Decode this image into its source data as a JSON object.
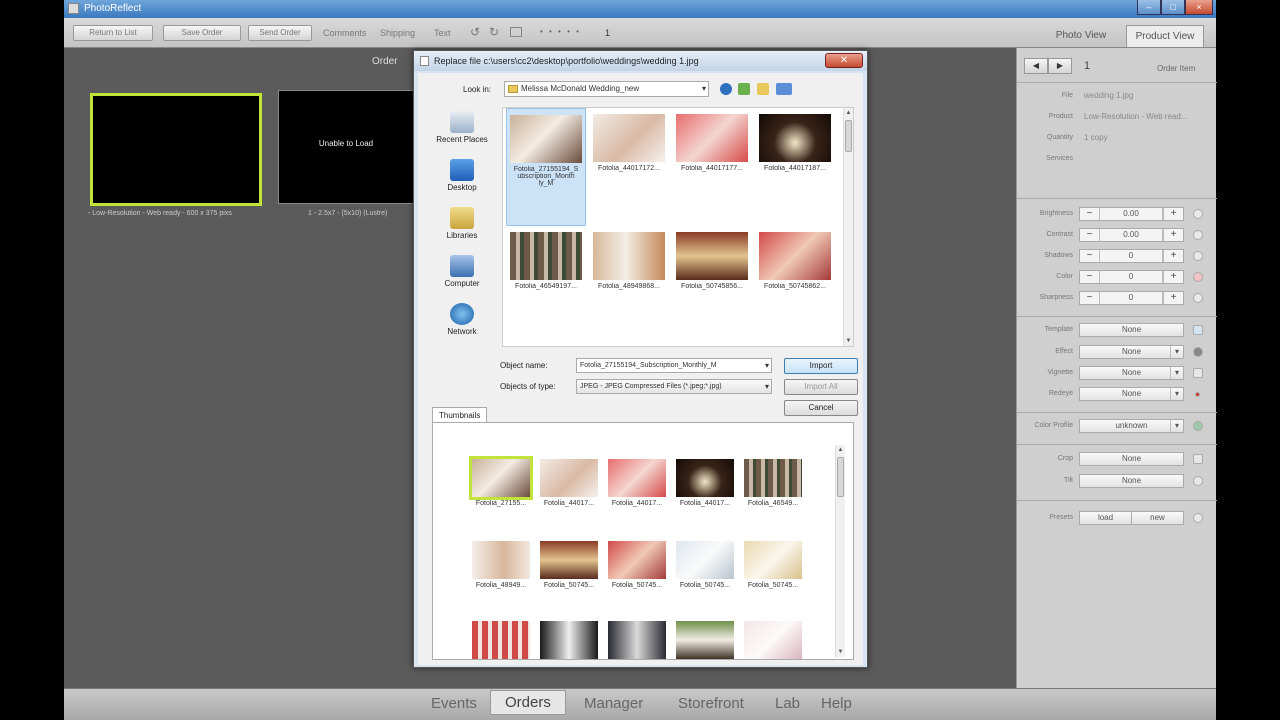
{
  "window": {
    "title": "PhotoReflect",
    "buttons": [
      "–",
      "□",
      "×"
    ]
  },
  "toolbar": {
    "return_label": "Return to List",
    "save_order_label": "Save Order",
    "send_order_label": "Send Order",
    "links": [
      "Comments",
      "Shipping",
      "Text"
    ],
    "page_indicator": "1"
  },
  "views": {
    "photo": "Photo View",
    "product": "Product View"
  },
  "workspace": {
    "order_label": "Order",
    "cards": [
      {
        "unable": "",
        "caption": "- Low-Resolution - Web ready - 600 x 375 pixs"
      },
      {
        "unable": "Unable to Load",
        "caption": "1 - 2.5x7 - (5x10) (Lustre)"
      }
    ]
  },
  "side": {
    "nav_prev": "◀",
    "nav_next": "▶",
    "item_number": "1",
    "order_item": "Order Item",
    "file_label": "File",
    "file_value": "wedding 1.jpg",
    "product_label": "Product",
    "product_value": "Low-Resolution - Web read...",
    "quantity_label": "Quantity",
    "quantity_value": "1 copy",
    "services_label": "Services",
    "adjust": [
      {
        "label": "Brightness",
        "value": "0.00"
      },
      {
        "label": "Contrast",
        "value": "0.00"
      },
      {
        "label": "Shadows",
        "value": "0"
      },
      {
        "label": "Color",
        "value": "0"
      },
      {
        "label": "Sharpness",
        "value": "0"
      }
    ],
    "dropdowns": [
      {
        "label": "Template",
        "value": "None"
      },
      {
        "label": "Effect",
        "value": "None"
      },
      {
        "label": "Vignette",
        "value": "None"
      },
      {
        "label": "Redeye",
        "value": "None"
      }
    ],
    "color_profile_label": "Color Profile",
    "color_profile_value": "unknown",
    "crop_label": "Crop",
    "crop_value": "None",
    "tilt_label": "Tilt",
    "tilt_value": "None",
    "presets_label": "Presets",
    "presets_load": "load",
    "presets_new": "new"
  },
  "bottom_tabs": [
    "Events",
    "Orders",
    "Manager",
    "Storefront",
    "Lab",
    "Help"
  ],
  "dialog": {
    "title": "Replace file c:\\users\\cc2\\desktop\\portfolio\\weddings\\wedding 1.jpg",
    "close": "✕",
    "look_in_label": "Look in:",
    "look_in_value": "Melissa McDonald Wedding_new",
    "places": [
      "Recent Places",
      "Desktop",
      "Libraries",
      "Computer",
      "Network"
    ],
    "files": [
      "Fotolia_27155194_Subscription_Monthly_M",
      "Fotolia_44017172...",
      "Fotolia_44017177...",
      "Fotolia_44017187...",
      "Fotolia_46549197...",
      "Fotolia_48949868...",
      "Fotolia_50745856...",
      "Fotolia_50745862..."
    ],
    "file_first_lines": [
      "Fotolia_27155194_S",
      "ubscription_Month",
      "ly_M"
    ],
    "object_name_label": "Object name:",
    "object_name_value": "Fotolia_27155194_Subscription_Monthly_M",
    "object_type_label": "Objects of type:",
    "object_type_value": "JPEG - JPEG Compressed Files (*.jpeg;*.jpg)",
    "import_label": "Import",
    "import_all_label": "Import All",
    "cancel_label": "Cancel",
    "thumbnails_tab": "Thumbnails",
    "thumbnails": [
      "Fotolia_27155...",
      "Fotolia_44017...",
      "Fotolia_44017...",
      "Fotolia_44017...",
      "Fotolia_46549...",
      "Fotolia_48949...",
      "Fotolia_50745...",
      "Fotolia_50745...",
      "Fotolia_50745...",
      "Fotolia_50745...",
      "",
      "",
      "",
      "",
      ""
    ]
  }
}
